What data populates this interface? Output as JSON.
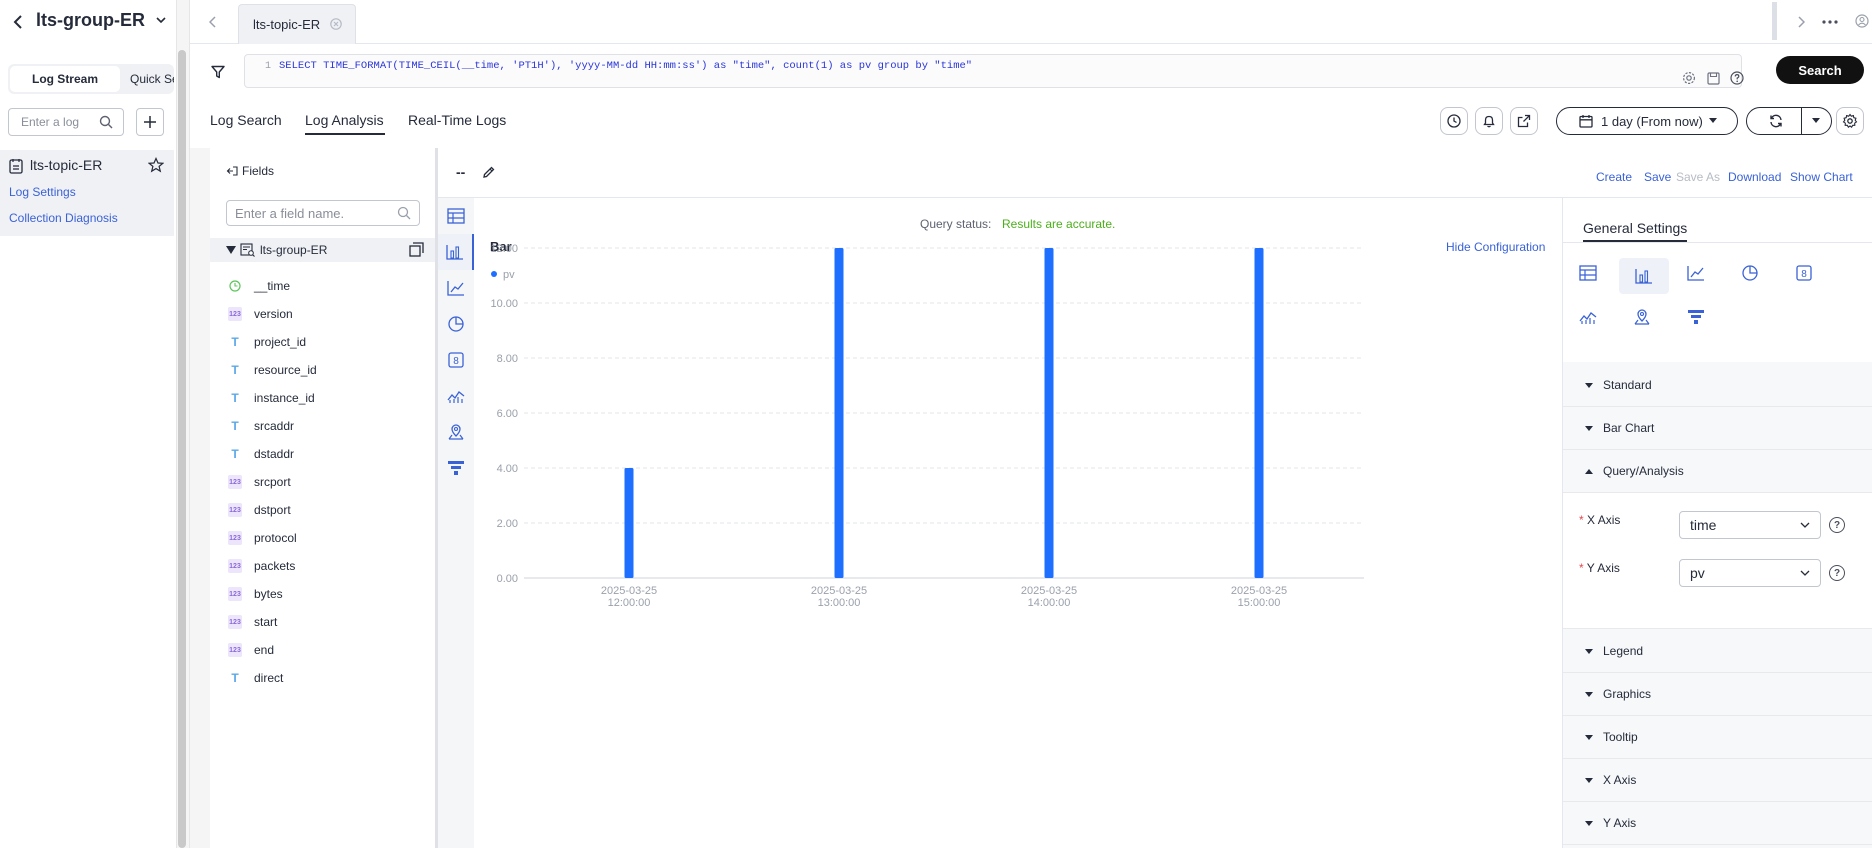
{
  "group": {
    "title": "lts-group-ER"
  },
  "left": {
    "tabs": [
      "Log Stream",
      "Quick Search"
    ],
    "search_placeholder": "Enter a log",
    "stream_name": "lts-topic-ER",
    "links": [
      "Log Settings",
      "Collection Diagnosis"
    ]
  },
  "topbar": {
    "tab_label": "lts-topic-ER"
  },
  "query": {
    "line_no": "1",
    "sql": "SELECT TIME_FORMAT(TIME_CEIL(__time, 'PT1H'), 'yyyy-MM-dd HH:mm:ss') as \"time\", count(1) as pv group by \"time\"",
    "search_label": "Search"
  },
  "subtabs": [
    "Log Search",
    "Log Analysis",
    "Real-Time Logs"
  ],
  "time_range": "1 day (From now)",
  "fields": {
    "title": "Fields",
    "search_placeholder": "Enter a field name.",
    "group_name": "lts-group-ER",
    "items": [
      {
        "name": "__time",
        "type": "time"
      },
      {
        "name": "version",
        "type": "num"
      },
      {
        "name": "project_id",
        "type": "text"
      },
      {
        "name": "resource_id",
        "type": "text"
      },
      {
        "name": "instance_id",
        "type": "text"
      },
      {
        "name": "srcaddr",
        "type": "text"
      },
      {
        "name": "dstaddr",
        "type": "text"
      },
      {
        "name": "srcport",
        "type": "num"
      },
      {
        "name": "dstport",
        "type": "num"
      },
      {
        "name": "protocol",
        "type": "num"
      },
      {
        "name": "packets",
        "type": "num"
      },
      {
        "name": "bytes",
        "type": "num"
      },
      {
        "name": "start",
        "type": "num"
      },
      {
        "name": "end",
        "type": "num"
      },
      {
        "name": "direct",
        "type": "text"
      }
    ],
    "type_glyphs": {
      "num": "123",
      "text": "T"
    }
  },
  "chart_header": {
    "name": "--",
    "actions": [
      "Create",
      "Save",
      "Save As",
      "Download",
      "Show Chart"
    ]
  },
  "chart_panel": {
    "status_label": "Query status:",
    "status_value": "Results are accurate.",
    "chart_title": "Bar",
    "hide_config": "Hide Configuration"
  },
  "chart_data": {
    "type": "bar",
    "title": "Bar",
    "categories": [
      "2025-03-25 12:00:00",
      "2025-03-25 13:00:00",
      "2025-03-25 14:00:00",
      "2025-03-25 15:00:00"
    ],
    "series": [
      {
        "name": "pv",
        "values": [
          4,
          12,
          12,
          12
        ],
        "color": "#1e6fff"
      }
    ],
    "yticks": [
      "0.00",
      "2.00",
      "4.00",
      "6.00",
      "8.00",
      "10.00",
      "12.00"
    ],
    "ylim": [
      0,
      12
    ],
    "grid": true,
    "legend": "top-left"
  },
  "config": {
    "title": "General Settings",
    "sections_top": [
      "Standard",
      "Bar Chart",
      "Query/Analysis"
    ],
    "x_axis_label": "X Axis",
    "x_axis_value": "time",
    "y_axis_label": "Y Axis",
    "y_axis_value": "pv",
    "sections_bottom": [
      "Legend",
      "Graphics",
      "Tooltip",
      "X Axis",
      "Y Axis"
    ]
  },
  "colors": {
    "accent": "#3a62d7",
    "bar": "#1e6fff",
    "success": "#4caf1a"
  }
}
